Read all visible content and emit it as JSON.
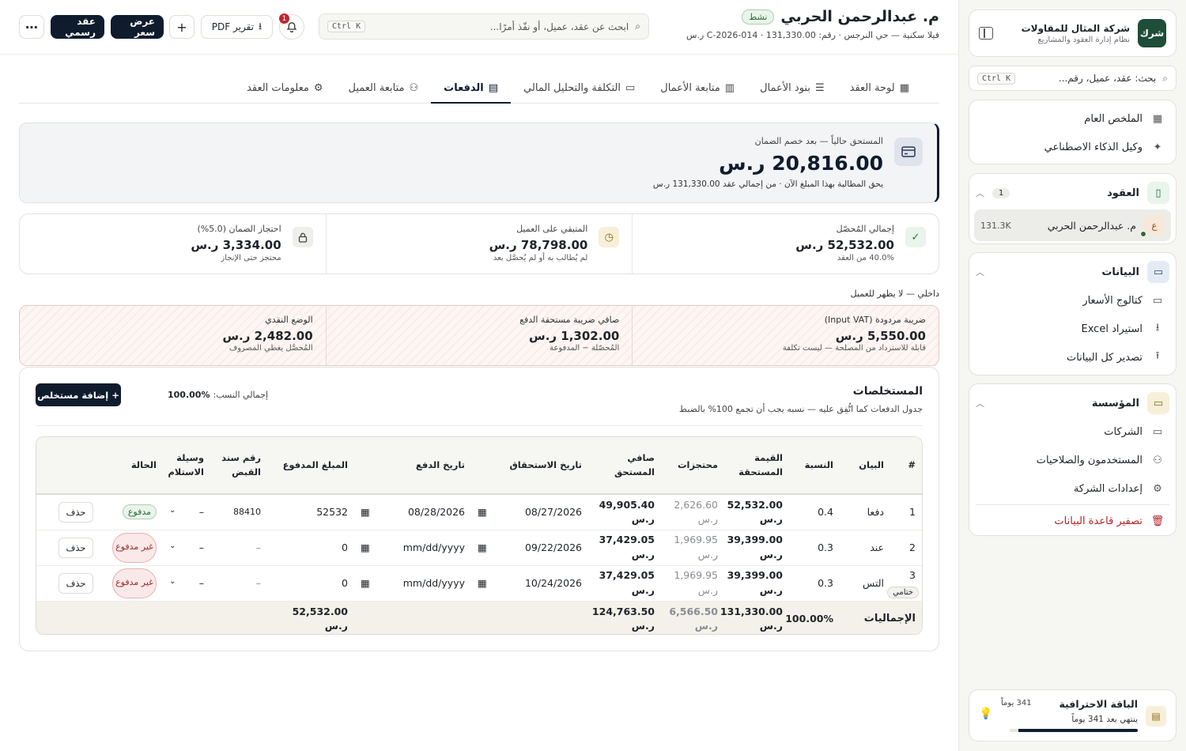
{
  "sidebar": {
    "brand": {
      "logo": "شرك",
      "name": "شركة المثال للمقاولات",
      "subtitle": "نظام إدارة العقود والمشاريع"
    },
    "search": {
      "placeholder": "بحث: عقد، عميل، رقم...",
      "shortcut": "Ctrl K"
    },
    "top_items": [
      {
        "label": "الملخص العام",
        "icon": "grid-icon"
      },
      {
        "label": "وكيل الذكاء الاصطناعي",
        "icon": "sparkle-icon"
      }
    ],
    "contracts": {
      "label": "العقود",
      "count": "1",
      "item": {
        "avatar": "ع",
        "name": "م. عبدالرحمن الحربي",
        "value": "131.3K"
      }
    },
    "data_section": {
      "label": "البيانات",
      "items": [
        {
          "label": "كتالوج الأسعار",
          "icon": "inbox-icon"
        },
        {
          "label": "استيراد Excel",
          "icon": "download-icon"
        },
        {
          "label": "تصدير كل البيانات",
          "icon": "upload-icon"
        }
      ]
    },
    "org_section": {
      "label": "المؤسسة",
      "items": [
        {
          "label": "الشركات",
          "icon": "briefcase-icon"
        },
        {
          "label": "المستخدمون والصلاحيات",
          "icon": "users-icon"
        },
        {
          "label": "إعدادات الشركة",
          "icon": "gear-icon"
        }
      ],
      "danger": "تصفير قاعدة البيانات"
    },
    "plan": {
      "name": "الباقة الاحترافية",
      "days": "341 يوماً",
      "expires": "ينتهي بعد 341 يوماً",
      "progress": 0.93
    }
  },
  "header": {
    "title": "م. عبدالرحمن الحربي",
    "status": "نشط",
    "subtitle": "فيلا سكنية — حي النرجس · رقم: C-2026-014 · 131,330.00 ر.س",
    "search_placeholder": "ابحث عن عقد، عميل، أو نفّذ أمرًا...",
    "search_shortcut": "Ctrl K",
    "notifications": "1",
    "buttons": {
      "pdf": "تقرير PDF",
      "quote": "عرض سعر",
      "formal": "عقد رسمي"
    }
  },
  "tabs": [
    {
      "label": "لوحة العقد",
      "icon": "grid-icon"
    },
    {
      "label": "بنود الأعمال",
      "icon": "list-icon"
    },
    {
      "label": "متابعة الأعمال",
      "icon": "kanban-icon"
    },
    {
      "label": "التكلفة والتحليل المالي",
      "icon": "briefcase-icon"
    },
    {
      "label": "الدفعات",
      "icon": "card-icon",
      "active": true
    },
    {
      "label": "متابعة العميل",
      "icon": "users-icon"
    },
    {
      "label": "معلومات العقد",
      "icon": "gear-icon"
    }
  ],
  "due": {
    "label": "المستحق حالياً — بعد خصم الضمان",
    "amount": "20,816.00 ر.س",
    "note": "يحق المطالبة بهذا المبلغ الآن · من إجمالي عقد 131,330.00 ر.س"
  },
  "stats": [
    {
      "label": "إجمالي المُحصّل",
      "value": "52,532.00 ر.س",
      "sub": "40.0% من العقد",
      "icon": "check-circle-icon",
      "color": "#2f6b3a",
      "bg": "#e9f4ea"
    },
    {
      "label": "المتبقي على العميل",
      "value": "78,798.00 ر.س",
      "sub": "لم يُطالب به أو لم يُحصَّل بعد",
      "icon": "clock-icon",
      "color": "#8a6d1c",
      "bg": "#f7efd9"
    },
    {
      "label": "احتجاز الضمان (5.0%)",
      "value": "3,334.00 ر.س",
      "sub": "محتجز حتى الإنجاز",
      "icon": "lock-icon",
      "color": "#444",
      "bg": "#eeeeea"
    }
  ],
  "internal": {
    "caption": "داخلي — لا يظهر للعميل",
    "items": [
      {
        "label": "ضريبة مردودة (Input VAT)",
        "value": "5,550.00 ر.س",
        "sub": "قابلة للاسترداد من المصلحة — ليست تكلفة"
      },
      {
        "label": "صافي ضريبة مستحقة الدفع",
        "value": "1,302.00 ر.س",
        "sub": "المُحصّلة − المدفوعة"
      },
      {
        "label": "الوضع النقدي",
        "value": "2,482.00 ر.س",
        "sub": "المُحصَّل يغطي المصروف"
      }
    ]
  },
  "schedule": {
    "title": "المستخلصات",
    "subtitle": "جدول الدفعات كما اتُّفِق عليه — نسبه يجب أن تجمع 100% بالضبط",
    "total_label": "إجمالي النسب:",
    "total_value": "100.00%",
    "add_button": "+ إضافة مستخلص",
    "columns": [
      "#",
      "البيان",
      "النسبة",
      "القيمة المستحقة",
      "محتجزات",
      "صافي المستحق",
      "تاريخ الاستحقاق",
      "تاريخ الدفع",
      "المبلغ المدفوع",
      "رقم سند القبض",
      "وسيلة الاستلام",
      "الحالة",
      ""
    ],
    "rows": [
      {
        "no": "1",
        "desc": "دفعا",
        "pct": "0.4",
        "due": "52,532.00 ر.س",
        "ret": "2,626.60 ر.س",
        "net": "49,905.40 ر.س",
        "due_date": "08/27/2026",
        "pay_date": "08/28/2026",
        "paid": "52532",
        "receipt": "88410",
        "method": "–",
        "status": "مدفوع",
        "paid_flag": true,
        "delete": "حذف"
      },
      {
        "no": "2",
        "desc": "عند",
        "pct": "0.3",
        "due": "39,399.00 ر.س",
        "ret": "1,969.95 ر.س",
        "net": "37,429.05 ر.س",
        "due_date": "09/22/2026",
        "pay_date": "mm/dd/yyyy",
        "paid": "0",
        "receipt": "–",
        "method": "–",
        "status": "غير مدفوع",
        "paid_flag": false,
        "delete": "حذف"
      },
      {
        "no": "3",
        "tag": "ختامي",
        "desc": "التس",
        "pct": "0.3",
        "due": "39,399.00 ر.س",
        "ret": "1,969.95 ر.س",
        "net": "37,429.05 ر.س",
        "due_date": "10/24/2026",
        "pay_date": "mm/dd/yyyy",
        "paid": "0",
        "receipt": "–",
        "method": "–",
        "status": "غير مدفوع",
        "paid_flag": false,
        "delete": "حذف"
      }
    ],
    "totals": {
      "label": "الإجماليات",
      "pct": "100.00%",
      "due": "131,330.00 ر.س",
      "ret": "6,566.50 ر.س",
      "net": "124,763.50 ر.س",
      "paid": "52,532.00 ر.س"
    }
  }
}
